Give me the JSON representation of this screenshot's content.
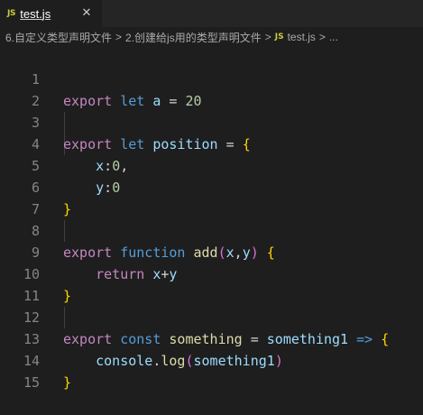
{
  "tab": {
    "badge": "JS",
    "title": "test.js",
    "close": "✕"
  },
  "breadcrumb": {
    "items": [
      "6.自定义类型声明文件",
      "2.创建给js用的类型声明文件"
    ],
    "file_badge": "JS",
    "file": "test.js",
    "more": "...",
    "separator": ">"
  },
  "editor": {
    "line_numbers": [
      "1",
      "2",
      "3",
      "4",
      "5",
      "6",
      "7",
      "8",
      "9",
      "10",
      "11",
      "12",
      "13",
      "14",
      "15"
    ],
    "lines": [
      {
        "export": "export",
        "let": "let",
        "name": "a",
        "eq": "=",
        "value": "20"
      },
      {},
      {
        "export": "export",
        "let": "let",
        "name": "position",
        "eq": "=",
        "brace": "{"
      },
      {
        "key": "x",
        "colon": ":",
        "value": "0",
        "comma": ","
      },
      {
        "key": "y",
        "colon": ":",
        "value": "0"
      },
      {
        "brace": "}"
      },
      {},
      {
        "export": "export",
        "function": "function",
        "name": "add",
        "p_open": "(",
        "p1": "x",
        "comma": ",",
        "p2": "y",
        "p_close": ")",
        "brace": "{"
      },
      {
        "return": "return",
        "expr1": "x",
        "plus": "+",
        "expr2": "y"
      },
      {
        "brace": "}"
      },
      {},
      {
        "export": "export",
        "const": "const",
        "name": "something",
        "eq": "=",
        "param": "something1",
        "arrow": "=>",
        "brace": "{"
      },
      {
        "obj": "console",
        "dot": ".",
        "method": "log",
        "p_open": "(",
        "arg": "something1",
        "p_close": ")"
      },
      {
        "brace": "}"
      },
      {}
    ]
  },
  "colors": {
    "background": "#1e1e1e",
    "keyword_control": "#c586c0",
    "keyword": "#569cd6",
    "variable": "#9cdcfe",
    "number": "#b5cea8",
    "function": "#dcdcaa",
    "brace": "#ffd700",
    "paren": "#da70d6",
    "js_badge": "#cbcb41"
  }
}
